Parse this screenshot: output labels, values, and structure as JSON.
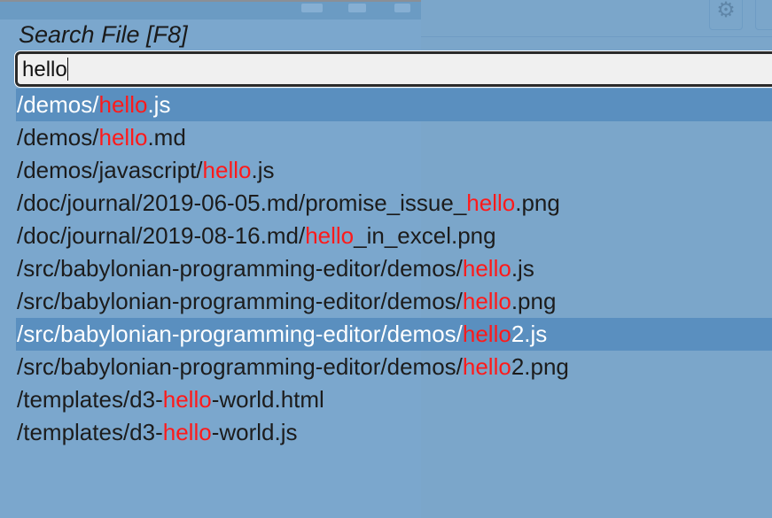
{
  "dialog": {
    "title": "Search File [F8]"
  },
  "search": {
    "value": "hello"
  },
  "results": [
    {
      "pre": "/demos/",
      "match": "hello",
      "post": ".js",
      "selected": true
    },
    {
      "pre": "/demos/",
      "match": "hello",
      "post": ".md",
      "selected": false
    },
    {
      "pre": "/demos/javascript/",
      "match": "hello",
      "post": ".js",
      "selected": false
    },
    {
      "pre": "/doc/journal/2019-06-05.md/promise_issue_",
      "match": "hello",
      "post": ".png",
      "selected": false
    },
    {
      "pre": "/doc/journal/2019-08-16.md/",
      "match": "hello",
      "post": "_in_excel.png",
      "selected": false
    },
    {
      "pre": "/src/babylonian-programming-editor/demos/",
      "match": "hello",
      "post": ".js",
      "selected": false
    },
    {
      "pre": "/src/babylonian-programming-editor/demos/",
      "match": "hello",
      "post": ".png",
      "selected": false
    },
    {
      "pre": "/src/babylonian-programming-editor/demos/",
      "match": "hello",
      "post": "2.js",
      "selected": true
    },
    {
      "pre": "/src/babylonian-programming-editor/demos/",
      "match": "hello",
      "post": "2.png",
      "selected": false
    },
    {
      "pre": "/templates/d3-",
      "match": "hello",
      "post": "-world.html",
      "selected": false
    },
    {
      "pre": "/templates/d3-",
      "match": "hello",
      "post": "-world.js",
      "selected": false
    }
  ],
  "colors": {
    "match": "#ff1a1a",
    "selected_row": "#5a8fbf",
    "background": "#7aa6cb"
  },
  "icons": {
    "settings": "gear-icon",
    "minimize": "minimize-icon",
    "maximize": "maximize-icon",
    "close": "close-icon"
  }
}
